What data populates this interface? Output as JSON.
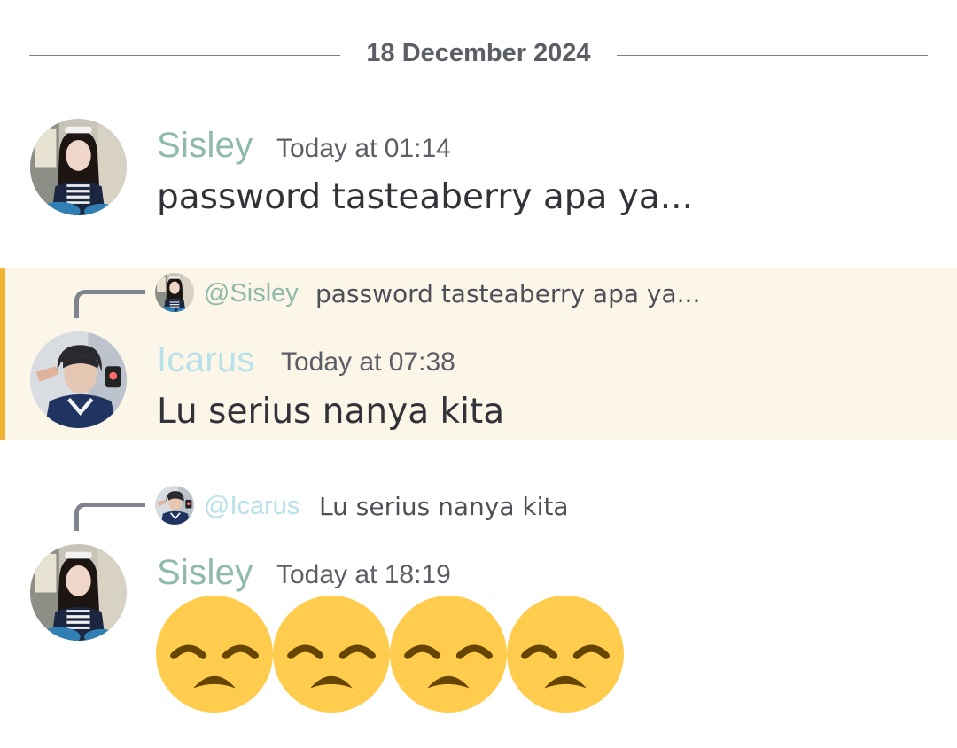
{
  "date_divider": "18 December 2024",
  "colors": {
    "sisley_name": "#8fb9aa",
    "icarus_name": "#b9e1ea",
    "highlight_bg": "#fcf6e9",
    "highlight_bar": "#f0b232",
    "emoji_face": "#ffcc4d",
    "emoji_feature": "#664500"
  },
  "messages": [
    {
      "author": "Sisley",
      "timestamp": "Today at 01:14",
      "content": "password tasteaberry apa ya...",
      "avatar": "sisley-avatar"
    },
    {
      "author": "Icarus",
      "timestamp": "Today at 07:38",
      "content": "Lu serius nanya kita",
      "avatar": "icarus-avatar",
      "highlighted": true,
      "reply": {
        "author": "@Sisley",
        "content": "password tasteaberry apa ya..."
      }
    },
    {
      "author": "Sisley",
      "timestamp": "Today at 18:19",
      "avatar": "sisley-avatar",
      "emojis": [
        "disappointed-face-emoji",
        "disappointed-face-emoji",
        "disappointed-face-emoji",
        "disappointed-face-emoji"
      ],
      "reply": {
        "author": "@Icarus",
        "content": "Lu serius nanya kita"
      }
    }
  ]
}
